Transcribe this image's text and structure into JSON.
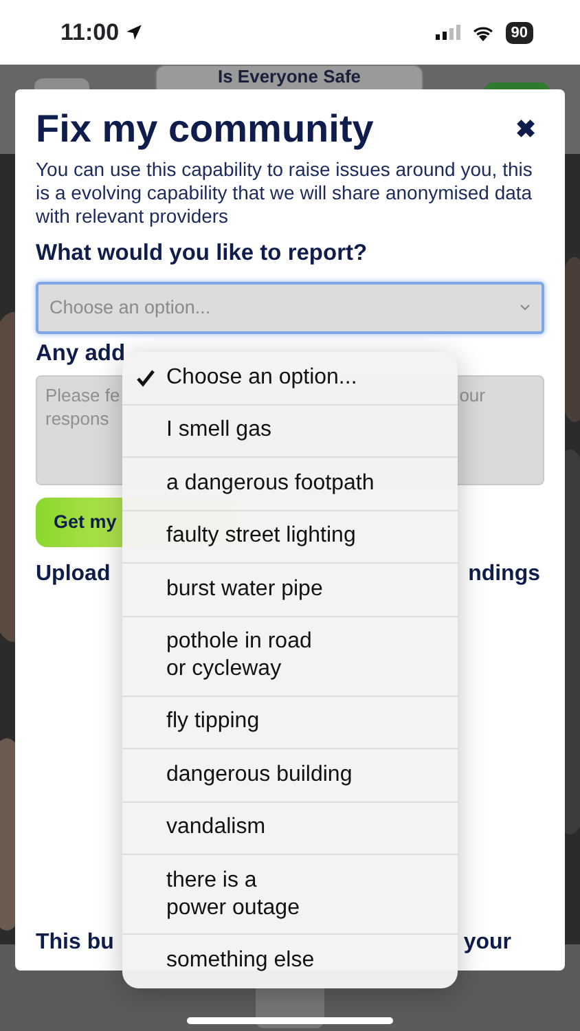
{
  "status_bar": {
    "time": "11:00",
    "battery": "90"
  },
  "background": {
    "header_title": "Is Everyone Safe"
  },
  "modal": {
    "title": "Fix my community",
    "close": "✖",
    "description": "You can use this capability to raise issues around you, this is a evolving capability that we will share anonymised data with relevant providers",
    "question": "What would you like to report?",
    "select": {
      "value": "Choose an option..."
    },
    "comments_label": "Any add",
    "comments": {
      "placeholder_left": [
        "Please fe",
        "respons"
      ],
      "placeholder_right": "our"
    },
    "button": "Get my",
    "upload": {
      "left": "Upload",
      "right": "ndings"
    },
    "footer": {
      "left": "This bu",
      "right": "your"
    }
  },
  "dropdown": {
    "options": [
      {
        "label": "Choose an option...",
        "selected": true
      },
      {
        "label": "I smell gas",
        "selected": false
      },
      {
        "label": "a dangerous footpath",
        "selected": false
      },
      {
        "label": "faulty street lighting",
        "selected": false
      },
      {
        "label": "burst water pipe",
        "selected": false
      },
      {
        "label": "pothole in road\nor cycleway",
        "selected": false
      },
      {
        "label": "fly tipping",
        "selected": false
      },
      {
        "label": "dangerous building",
        "selected": false
      },
      {
        "label": "vandalism",
        "selected": false
      },
      {
        "label": "there is a\npower outage",
        "selected": false
      },
      {
        "label": "something else",
        "selected": false
      }
    ]
  }
}
